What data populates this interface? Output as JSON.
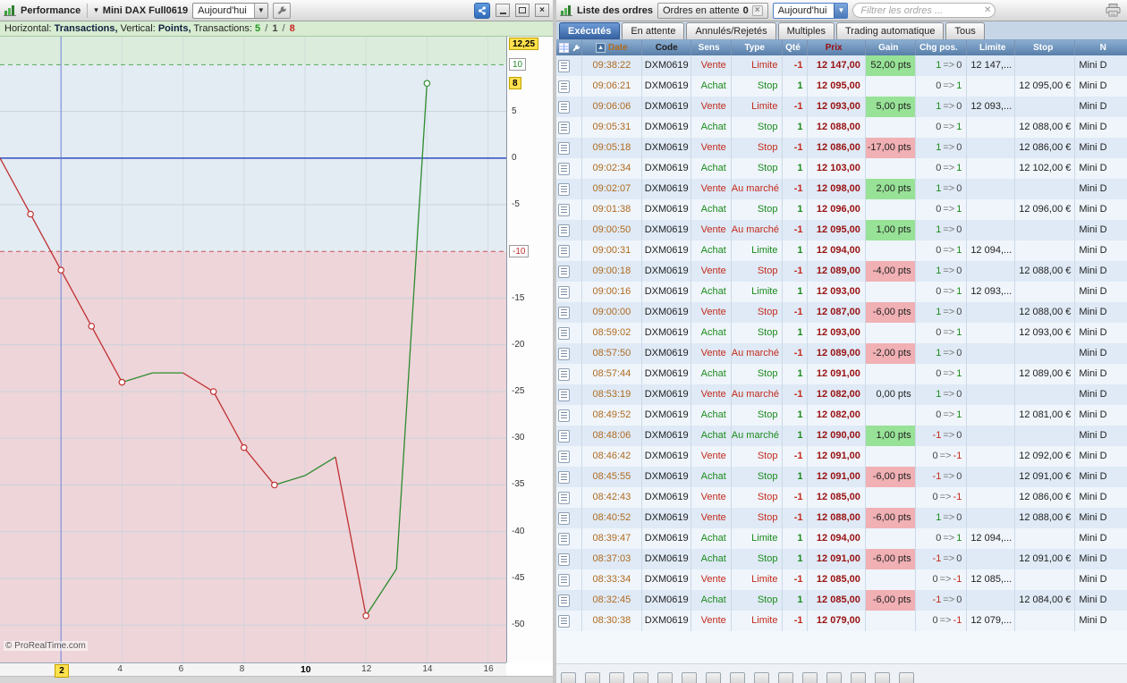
{
  "left_panel": {
    "window_title": "Performance",
    "instrument": "Mini DAX Full0619",
    "period": "Aujourd'hui",
    "info_bar": {
      "horizontal_label": "Horizontal:",
      "horizontal_value": "Transactions,",
      "vertical_label": "Vertical:",
      "vertical_value": "Points,",
      "transactions_label": "Transactions:",
      "wins": "5",
      "neutral": "1",
      "losses": "8",
      "separator": "/"
    },
    "copyright": "© ProRealTime.com",
    "y_axis_labels": [
      {
        "text": "12,25",
        "value": 12.25,
        "style": "cursor"
      },
      {
        "text": "10",
        "value": 10,
        "style": "max"
      },
      {
        "text": "8",
        "value": 8,
        "style": "last"
      },
      {
        "text": "5",
        "value": 5,
        "style": "plain"
      },
      {
        "text": "0",
        "value": 0,
        "style": "plain"
      },
      {
        "text": "-5",
        "value": -5,
        "style": "plain"
      },
      {
        "text": "-10",
        "value": -10,
        "style": "min"
      },
      {
        "text": "-15",
        "value": -15,
        "style": "plain"
      },
      {
        "text": "-20",
        "value": -20,
        "style": "plain"
      },
      {
        "text": "-25",
        "value": -25,
        "style": "plain"
      },
      {
        "text": "-30",
        "value": -30,
        "style": "plain"
      },
      {
        "text": "-35",
        "value": -35,
        "style": "plain"
      },
      {
        "text": "-40",
        "value": -40,
        "style": "plain"
      },
      {
        "text": "-45",
        "value": -45,
        "style": "plain"
      },
      {
        "text": "-50",
        "value": -50,
        "style": "plain"
      }
    ],
    "x_axis_labels": [
      {
        "text": "2",
        "value": 2,
        "style": "cursor"
      },
      {
        "text": "4",
        "value": 4,
        "style": "plain"
      },
      {
        "text": "6",
        "value": 6,
        "style": "plain"
      },
      {
        "text": "8",
        "value": 8,
        "style": "plain"
      },
      {
        "text": "10",
        "value": 10,
        "style": "bold"
      },
      {
        "text": "12",
        "value": 12,
        "style": "plain"
      },
      {
        "text": "14",
        "value": 14,
        "style": "plain"
      },
      {
        "text": "16",
        "value": 16,
        "style": "plain"
      }
    ]
  },
  "chart_data": {
    "type": "line",
    "title": "Performance",
    "xlabel": "Transactions",
    "ylabel": "Points",
    "x": [
      0,
      1,
      2,
      3,
      4,
      5,
      6,
      7,
      8,
      9,
      10,
      11,
      12,
      13,
      14
    ],
    "cumulative_points": [
      0,
      -6,
      -12,
      -18,
      -24,
      -23,
      -23,
      -25,
      -31,
      -35,
      -34,
      -32,
      -49,
      -44,
      8
    ],
    "trade_gains": [
      -6,
      -6,
      -6,
      -6,
      1,
      0,
      -2,
      -6,
      -4,
      1,
      2,
      -17,
      5,
      52
    ],
    "marker_indices": [
      1,
      2,
      3,
      4,
      7,
      8,
      9,
      12,
      14
    ],
    "xlim": [
      0,
      16.6
    ],
    "ylim": [
      -54,
      13
    ],
    "zero_line": 0,
    "upper_threshold": 10,
    "lower_threshold": -10,
    "cursor_x": 2,
    "cursor_value_label": "12,25",
    "last_value": 8,
    "transactions_summary": {
      "wins": 5,
      "neutral": 1,
      "losses": 8
    },
    "colors": {
      "gain": "#2e8b2e",
      "loss": "#c03030",
      "zone_upper": "#dcecdc",
      "zone_middle": "#e3ebf3",
      "zone_lower": "#edd5da",
      "zero_line": "#2f4cc0",
      "cursor_line": "#6f87d8",
      "grid": "#c9d2da",
      "dashed_upper": "#55aa55",
      "dashed_lower": "#cc5555"
    }
  },
  "right_panel": {
    "title": "Liste des ordres",
    "pending_orders_button": "Ordres en attente",
    "pending_orders_count": "0",
    "period": "Aujourd'hui",
    "filter_placeholder": "Filtrer les ordres ...",
    "tabs": [
      {
        "label": "Exécutés",
        "active": true
      },
      {
        "label": "En attente",
        "active": false
      },
      {
        "label": "Annulés/Rejetés",
        "active": false
      },
      {
        "label": "Multiples",
        "active": false
      },
      {
        "label": "Trading automatique",
        "active": false
      },
      {
        "label": "Tous",
        "active": false
      }
    ],
    "table": {
      "columns": {
        "date": "Date",
        "code": "Code",
        "sens": "Sens",
        "type": "Type",
        "qty": "Qté",
        "prix": "Prix",
        "gain": "Gain",
        "chg": "Chg pos.",
        "limite": "Limite",
        "stop": "Stop",
        "nom": "N"
      },
      "rows": [
        {
          "time": "09:38:22",
          "code": "DXM0619",
          "sens": "Vente",
          "type": "Limite",
          "qty": "-1",
          "prix": "12 147,00",
          "gain": "52,00 pts",
          "gain_type": "pos",
          "chg": "1 => 0",
          "limite": "12 147,...",
          "stop": "",
          "nom": "Mini D"
        },
        {
          "time": "09:06:21",
          "code": "DXM0619",
          "sens": "Achat",
          "type": "Stop",
          "qty": "1",
          "prix": "12 095,00",
          "gain": "",
          "gain_type": "",
          "chg": "0 => 1",
          "limite": "",
          "stop": "12 095,00 €",
          "nom": "Mini D"
        },
        {
          "time": "09:06:06",
          "code": "DXM0619",
          "sens": "Vente",
          "type": "Limite",
          "qty": "-1",
          "prix": "12 093,00",
          "gain": "5,00 pts",
          "gain_type": "pos",
          "chg": "1 => 0",
          "limite": "12 093,...",
          "stop": "",
          "nom": "Mini D"
        },
        {
          "time": "09:05:31",
          "code": "DXM0619",
          "sens": "Achat",
          "type": "Stop",
          "qty": "1",
          "prix": "12 088,00",
          "gain": "",
          "gain_type": "",
          "chg": "0 => 1",
          "limite": "",
          "stop": "12 088,00 €",
          "nom": "Mini D"
        },
        {
          "time": "09:05:18",
          "code": "DXM0619",
          "sens": "Vente",
          "type": "Stop",
          "qty": "-1",
          "prix": "12 086,00",
          "gain": "-17,00 pts",
          "gain_type": "neg",
          "chg": "1 => 0",
          "limite": "",
          "stop": "12 086,00 €",
          "nom": "Mini D"
        },
        {
          "time": "09:02:34",
          "code": "DXM0619",
          "sens": "Achat",
          "type": "Stop",
          "qty": "1",
          "prix": "12 103,00",
          "gain": "",
          "gain_type": "",
          "chg": "0 => 1",
          "limite": "",
          "stop": "12 102,00 €",
          "nom": "Mini D"
        },
        {
          "time": "09:02:07",
          "code": "DXM0619",
          "sens": "Vente",
          "type": "Au marché",
          "qty": "-1",
          "prix": "12 098,00",
          "gain": "2,00 pts",
          "gain_type": "pos",
          "chg": "1 => 0",
          "limite": "",
          "stop": "",
          "nom": "Mini D"
        },
        {
          "time": "09:01:38",
          "code": "DXM0619",
          "sens": "Achat",
          "type": "Stop",
          "qty": "1",
          "prix": "12 096,00",
          "gain": "",
          "gain_type": "",
          "chg": "0 => 1",
          "limite": "",
          "stop": "12 096,00 €",
          "nom": "Mini D"
        },
        {
          "time": "09:00:50",
          "code": "DXM0619",
          "sens": "Vente",
          "type": "Au marché",
          "qty": "-1",
          "prix": "12 095,00",
          "gain": "1,00 pts",
          "gain_type": "pos",
          "chg": "1 => 0",
          "limite": "",
          "stop": "",
          "nom": "Mini D"
        },
        {
          "time": "09:00:31",
          "code": "DXM0619",
          "sens": "Achat",
          "type": "Limite",
          "qty": "1",
          "prix": "12 094,00",
          "gain": "",
          "gain_type": "",
          "chg": "0 => 1",
          "limite": "12 094,...",
          "stop": "",
          "nom": "Mini D"
        },
        {
          "time": "09:00:18",
          "code": "DXM0619",
          "sens": "Vente",
          "type": "Stop",
          "qty": "-1",
          "prix": "12 089,00",
          "gain": "-4,00 pts",
          "gain_type": "neg",
          "chg": "1 => 0",
          "limite": "",
          "stop": "12 088,00 €",
          "nom": "Mini D"
        },
        {
          "time": "09:00:16",
          "code": "DXM0619",
          "sens": "Achat",
          "type": "Limite",
          "qty": "1",
          "prix": "12 093,00",
          "gain": "",
          "gain_type": "",
          "chg": "0 => 1",
          "limite": "12 093,...",
          "stop": "",
          "nom": "Mini D"
        },
        {
          "time": "09:00:00",
          "code": "DXM0619",
          "sens": "Vente",
          "type": "Stop",
          "qty": "-1",
          "prix": "12 087,00",
          "gain": "-6,00 pts",
          "gain_type": "neg",
          "chg": "1 => 0",
          "limite": "",
          "stop": "12 088,00 €",
          "nom": "Mini D"
        },
        {
          "time": "08:59:02",
          "code": "DXM0619",
          "sens": "Achat",
          "type": "Stop",
          "qty": "1",
          "prix": "12 093,00",
          "gain": "",
          "gain_type": "",
          "chg": "0 => 1",
          "limite": "",
          "stop": "12 093,00 €",
          "nom": "Mini D"
        },
        {
          "time": "08:57:50",
          "code": "DXM0619",
          "sens": "Vente",
          "type": "Au marché",
          "qty": "-1",
          "prix": "12 089,00",
          "gain": "-2,00 pts",
          "gain_type": "neg",
          "chg": "1 => 0",
          "limite": "",
          "stop": "",
          "nom": "Mini D"
        },
        {
          "time": "08:57:44",
          "code": "DXM0619",
          "sens": "Achat",
          "type": "Stop",
          "qty": "1",
          "prix": "12 091,00",
          "gain": "",
          "gain_type": "",
          "chg": "0 => 1",
          "limite": "",
          "stop": "12 089,00 €",
          "nom": "Mini D"
        },
        {
          "time": "08:53:19",
          "code": "DXM0619",
          "sens": "Vente",
          "type": "Au marché",
          "qty": "-1",
          "prix": "12 082,00",
          "gain": "0,00 pts",
          "gain_type": "zero",
          "chg": "1 => 0",
          "limite": "",
          "stop": "",
          "nom": "Mini D"
        },
        {
          "time": "08:49:52",
          "code": "DXM0619",
          "sens": "Achat",
          "type": "Stop",
          "qty": "1",
          "prix": "12 082,00",
          "gain": "",
          "gain_type": "",
          "chg": "0 => 1",
          "limite": "",
          "stop": "12 081,00 €",
          "nom": "Mini D"
        },
        {
          "time": "08:48:06",
          "code": "DXM0619",
          "sens": "Achat",
          "type": "Au marché",
          "qty": "1",
          "prix": "12 090,00",
          "gain": "1,00 pts",
          "gain_type": "pos",
          "chg": "-1 => 0",
          "limite": "",
          "stop": "",
          "nom": "Mini D"
        },
        {
          "time": "08:46:42",
          "code": "DXM0619",
          "sens": "Vente",
          "type": "Stop",
          "qty": "-1",
          "prix": "12 091,00",
          "gain": "",
          "gain_type": "",
          "chg": "0 => -1",
          "limite": "",
          "stop": "12 092,00 €",
          "nom": "Mini D"
        },
        {
          "time": "08:45:55",
          "code": "DXM0619",
          "sens": "Achat",
          "type": "Stop",
          "qty": "1",
          "prix": "12 091,00",
          "gain": "-6,00 pts",
          "gain_type": "neg",
          "chg": "-1 => 0",
          "limite": "",
          "stop": "12 091,00 €",
          "nom": "Mini D"
        },
        {
          "time": "08:42:43",
          "code": "DXM0619",
          "sens": "Vente",
          "type": "Stop",
          "qty": "-1",
          "prix": "12 085,00",
          "gain": "",
          "gain_type": "",
          "chg": "0 => -1",
          "limite": "",
          "stop": "12 086,00 €",
          "nom": "Mini D"
        },
        {
          "time": "08:40:52",
          "code": "DXM0619",
          "sens": "Vente",
          "type": "Stop",
          "qty": "-1",
          "prix": "12 088,00",
          "gain": "-6,00 pts",
          "gain_type": "neg",
          "chg": "1 => 0",
          "limite": "",
          "stop": "12 088,00 €",
          "nom": "Mini D"
        },
        {
          "time": "08:39:47",
          "code": "DXM0619",
          "sens": "Achat",
          "type": "Limite",
          "qty": "1",
          "prix": "12 094,00",
          "gain": "",
          "gain_type": "",
          "chg": "0 => 1",
          "limite": "12 094,...",
          "stop": "",
          "nom": "Mini D"
        },
        {
          "time": "08:37:03",
          "code": "DXM0619",
          "sens": "Achat",
          "type": "Stop",
          "qty": "1",
          "prix": "12 091,00",
          "gain": "-6,00 pts",
          "gain_type": "neg",
          "chg": "-1 => 0",
          "limite": "",
          "stop": "12 091,00 €",
          "nom": "Mini D"
        },
        {
          "time": "08:33:34",
          "code": "DXM0619",
          "sens": "Vente",
          "type": "Limite",
          "qty": "-1",
          "prix": "12 085,00",
          "gain": "",
          "gain_type": "",
          "chg": "0 => -1",
          "limite": "12 085,...",
          "stop": "",
          "nom": "Mini D"
        },
        {
          "time": "08:32:45",
          "code": "DXM0619",
          "sens": "Achat",
          "type": "Stop",
          "qty": "1",
          "prix": "12 085,00",
          "gain": "-6,00 pts",
          "gain_type": "neg",
          "chg": "-1 => 0",
          "limite": "",
          "stop": "12 084,00 €",
          "nom": "Mini D"
        },
        {
          "time": "08:30:38",
          "code": "DXM0619",
          "sens": "Vente",
          "type": "Limite",
          "qty": "-1",
          "prix": "12 079,00",
          "gain": "",
          "gain_type": "",
          "chg": "0 => -1",
          "limite": "12 079,...",
          "stop": "",
          "nom": "Mini D"
        }
      ]
    }
  }
}
